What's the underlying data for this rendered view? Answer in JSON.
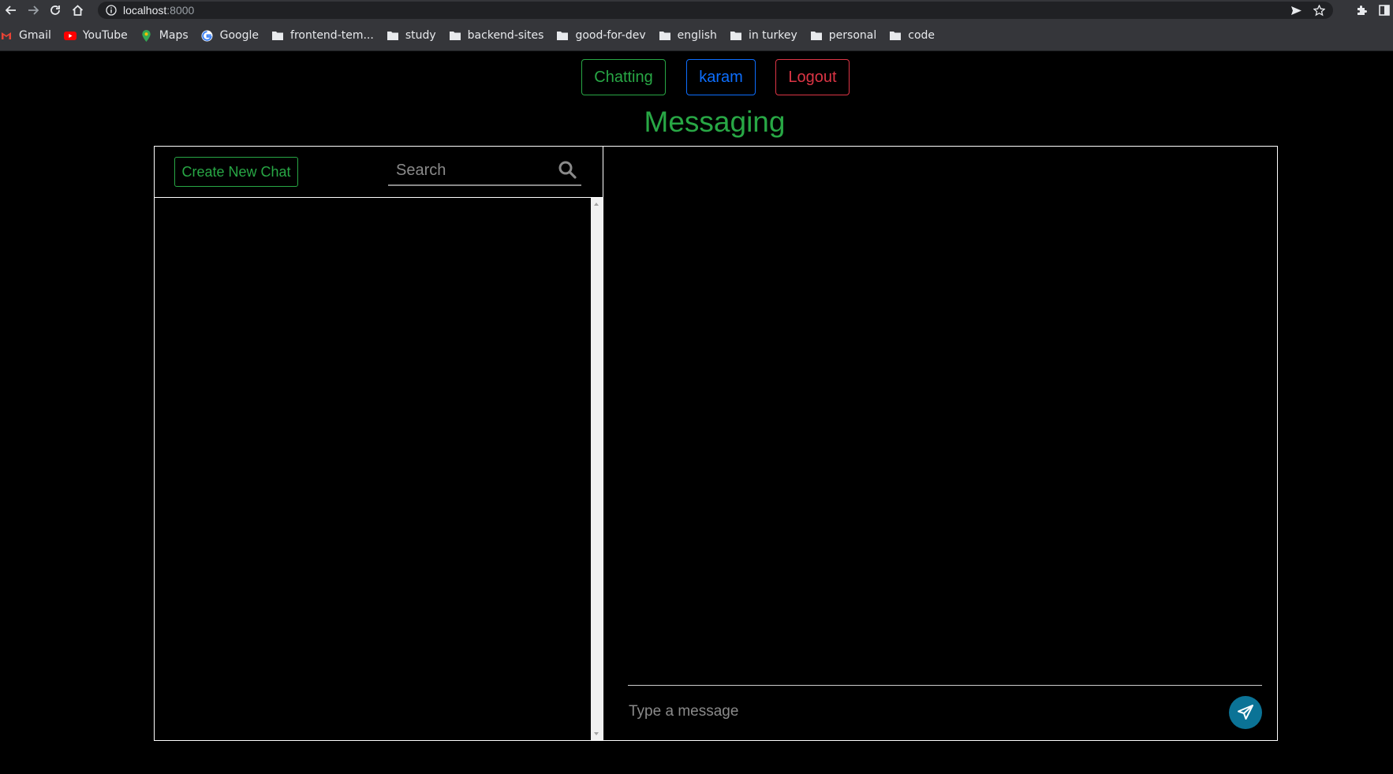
{
  "browser": {
    "url_host": "localhost",
    "url_port": ":8000",
    "bookmarks": [
      {
        "label": "Gmail",
        "icon": "gmail-icon"
      },
      {
        "label": "YouTube",
        "icon": "youtube-icon"
      },
      {
        "label": "Maps",
        "icon": "maps-icon"
      },
      {
        "label": "Google",
        "icon": "google-icon"
      },
      {
        "label": "frontend-tem...",
        "icon": "folder-icon"
      },
      {
        "label": "study",
        "icon": "folder-icon"
      },
      {
        "label": "backend-sites",
        "icon": "folder-icon"
      },
      {
        "label": "good-for-dev",
        "icon": "folder-icon"
      },
      {
        "label": "english",
        "icon": "folder-icon"
      },
      {
        "label": "in turkey",
        "icon": "folder-icon"
      },
      {
        "label": "personal",
        "icon": "folder-icon"
      },
      {
        "label": "code",
        "icon": "folder-icon"
      }
    ]
  },
  "nav": {
    "chatting_label": "Chatting",
    "user_label": "karam",
    "logout_label": "Logout"
  },
  "page": {
    "title": "Messaging"
  },
  "sidebar": {
    "create_label": "Create New Chat",
    "search_placeholder": "Search"
  },
  "chat": {
    "message_placeholder": "Type a message"
  },
  "colors": {
    "green": "#28a745",
    "blue": "#0d6efd",
    "red": "#dc3545",
    "send": "#0b7396"
  }
}
